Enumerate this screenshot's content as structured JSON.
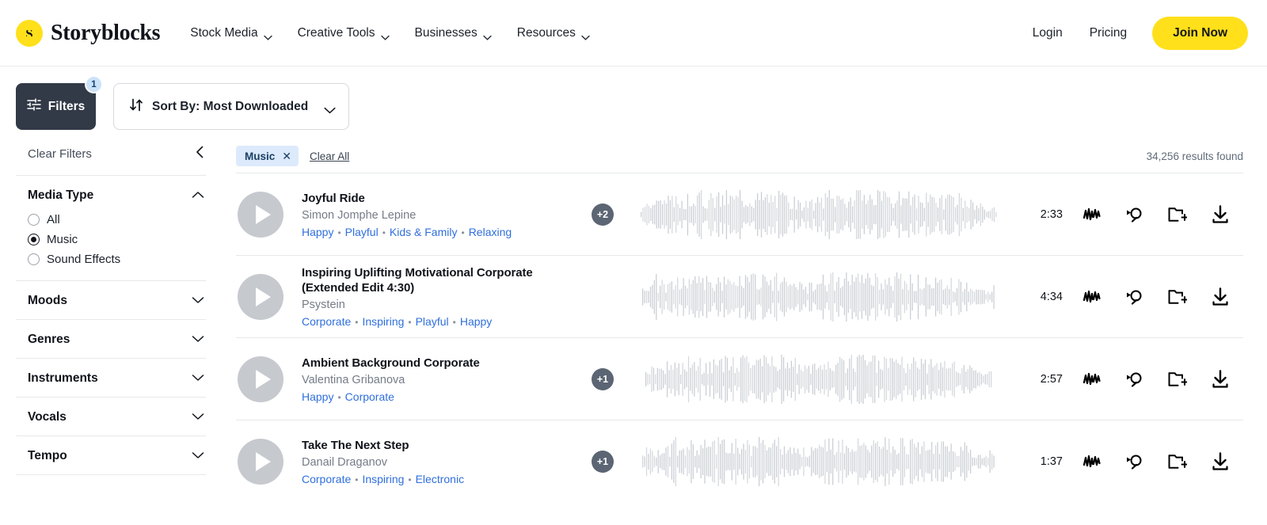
{
  "header": {
    "brand": "Storyblocks",
    "brand_icon": "storyblocks-logo-icon",
    "nav": [
      {
        "label": "Stock Media",
        "icon": "chevron-down-icon"
      },
      {
        "label": "Creative Tools",
        "icon": "chevron-down-icon"
      },
      {
        "label": "Businesses",
        "icon": "chevron-down-icon"
      },
      {
        "label": "Resources",
        "icon": "chevron-down-icon"
      }
    ],
    "login": "Login",
    "pricing": "Pricing",
    "join": "Join Now",
    "join_color": "#ffe01b"
  },
  "controls": {
    "filters_label": "Filters",
    "filters_icon": "sliders-icon",
    "filters_badge": "1",
    "filters_badge_color": "#cbe2f9",
    "sort_icon": "sort-arrows-icon",
    "sort_label": "Sort By: Most Downloaded",
    "sort_chevron": "chevron-down-icon"
  },
  "sidebar": {
    "clear_filters": "Clear Filters",
    "collapse_icon": "chevron-left-icon",
    "media_type": {
      "title": "Media Type",
      "chevron": "chevron-up-icon",
      "options": [
        {
          "label": "All",
          "selected": false
        },
        {
          "label": "Music",
          "selected": true
        },
        {
          "label": "Sound Effects",
          "selected": false
        }
      ]
    },
    "sections": [
      {
        "title": "Moods",
        "chevron": "chevron-down-icon"
      },
      {
        "title": "Genres",
        "chevron": "chevron-down-icon"
      },
      {
        "title": "Instruments",
        "chevron": "chevron-down-icon"
      },
      {
        "title": "Vocals",
        "chevron": "chevron-down-icon"
      },
      {
        "title": "Tempo",
        "chevron": "chevron-down-icon"
      }
    ]
  },
  "results_bar": {
    "chip_label": "Music",
    "chip_remove_icon": "close-icon",
    "clear_all": "Clear All",
    "count": "34,256 results found"
  },
  "row_actions": [
    {
      "name": "similar-music-icon",
      "tooltip": "Find similar music"
    },
    {
      "name": "search-similar-icon",
      "tooltip": "Search similar"
    },
    {
      "name": "add-to-folder-icon",
      "tooltip": "Add to folder"
    },
    {
      "name": "download-icon",
      "tooltip": "Download"
    }
  ],
  "results": [
    {
      "title": "Joyful Ride",
      "artist": "Simon Jomphe Lepine",
      "tags": [
        "Happy",
        "Playful",
        "Kids & Family",
        "Relaxing"
      ],
      "more_badge": "+2",
      "duration": "2:33",
      "play_icon": "play-icon"
    },
    {
      "title": "Inspiring Uplifting Motivational Corporate (Extended Edit 4:30)",
      "artist": "Psystein",
      "tags": [
        "Corporate",
        "Inspiring",
        "Playful",
        "Happy"
      ],
      "more_badge": "",
      "duration": "4:34",
      "play_icon": "play-icon"
    },
    {
      "title": "Ambient Background Corporate",
      "artist": "Valentina Gribanova",
      "tags": [
        "Happy",
        "Corporate"
      ],
      "more_badge": "+1",
      "duration": "2:57",
      "play_icon": "play-icon"
    },
    {
      "title": "Take The Next Step",
      "artist": "Danail Draganov",
      "tags": [
        "Corporate",
        "Inspiring",
        "Electronic"
      ],
      "more_badge": "+1",
      "duration": "1:37",
      "play_icon": "play-icon"
    }
  ]
}
